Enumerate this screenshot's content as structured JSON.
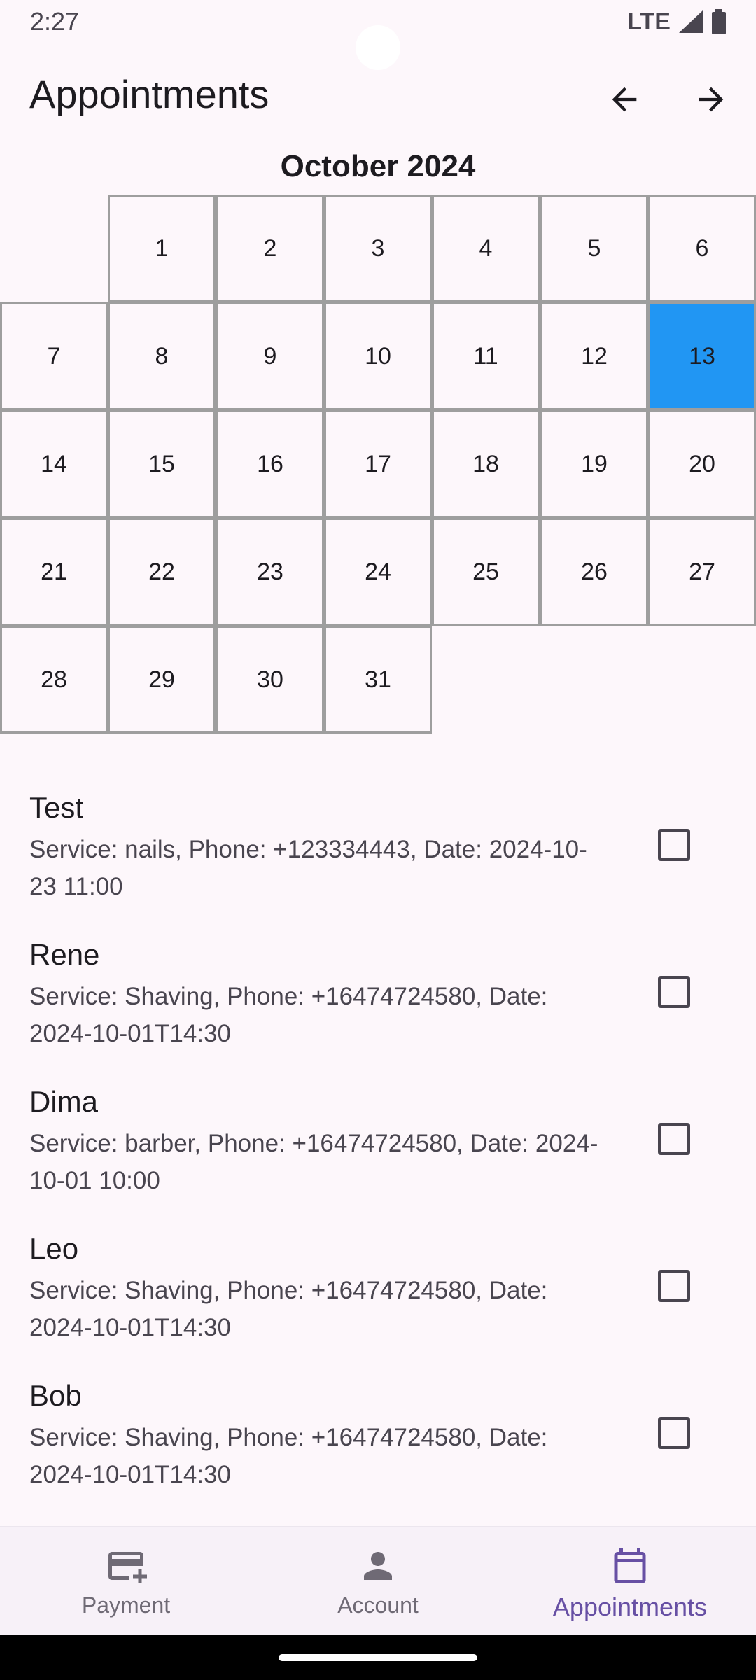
{
  "status_bar": {
    "time": "2:27",
    "network": "LTE"
  },
  "app_bar": {
    "title": "Appointments"
  },
  "calendar": {
    "month_title": "October 2024",
    "days": [
      "1",
      "2",
      "3",
      "4",
      "5",
      "6",
      "7",
      "8",
      "9",
      "10",
      "11",
      "12",
      "13",
      "14",
      "15",
      "16",
      "17",
      "18",
      "19",
      "20",
      "21",
      "22",
      "23",
      "24",
      "25",
      "26",
      "27",
      "28",
      "29",
      "30",
      "31"
    ],
    "first_weekday_offset": 1,
    "selected_day": "13",
    "selected_color": "#2196f3"
  },
  "appointments": [
    {
      "name": "Test",
      "details": "Service: nails, Phone: +123334443, Date: 2024-10-23 11:00",
      "checked": false
    },
    {
      "name": "Rene",
      "details": "Service: Shaving, Phone: +16474724580, Date: 2024-10-01T14:30",
      "checked": false
    },
    {
      "name": "Dima",
      "details": "Service: barber, Phone: +16474724580, Date: 2024-10-01 10:00",
      "checked": false
    },
    {
      "name": "Leo",
      "details": "Service: Shaving, Phone: +16474724580, Date: 2024-10-01T14:30",
      "checked": false
    },
    {
      "name": "Bob",
      "details": "Service: Shaving, Phone: +16474724580, Date: 2024-10-01T14:30",
      "checked": false
    }
  ],
  "bottom_nav": {
    "items": [
      {
        "label": "Payment",
        "icon": "add-card-icon",
        "active": false
      },
      {
        "label": "Account",
        "icon": "person-icon",
        "active": false
      },
      {
        "label": "Appointments",
        "icon": "calendar-icon",
        "active": true
      }
    ],
    "active_color": "#6750a4"
  }
}
